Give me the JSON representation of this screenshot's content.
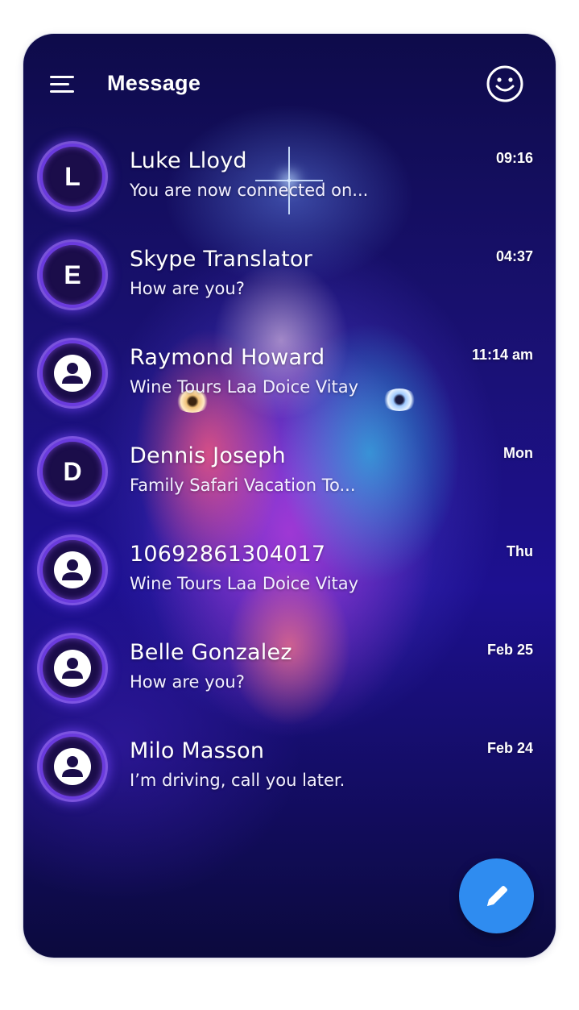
{
  "header": {
    "title": "Message",
    "menu_icon": "hamburger-menu-icon",
    "theme_icon": "smiley-face-icon"
  },
  "conversations": [
    {
      "avatar_type": "letter",
      "initial": "L",
      "name": "Luke Lloyd",
      "preview": "You are now connected on...",
      "time": "09:16"
    },
    {
      "avatar_type": "letter",
      "initial": "E",
      "name": "Skype Translator",
      "preview": "How are you?",
      "time": "04:37"
    },
    {
      "avatar_type": "person",
      "initial": "",
      "name": "Raymond Howard",
      "preview": "Wine Tours Laa Doice Vitay",
      "time": "11:14 am"
    },
    {
      "avatar_type": "letter",
      "initial": "D",
      "name": "Dennis Joseph",
      "preview": "Family Safari Vacation To...",
      "time": "Mon"
    },
    {
      "avatar_type": "person",
      "initial": "",
      "name": "10692861304017",
      "preview": "Wine Tours Laa Doice Vitay",
      "time": "Thu"
    },
    {
      "avatar_type": "person",
      "initial": "",
      "name": "Belle Gonzalez",
      "preview": "How are you?",
      "time": "Feb 25"
    },
    {
      "avatar_type": "person",
      "initial": "",
      "name": "Milo Masson",
      "preview": "I’m driving, call you later.",
      "time": "Feb 24"
    }
  ],
  "compose": {
    "icon": "pencil-icon",
    "color": "#2f8cf0"
  },
  "colors": {
    "avatar_ring": "#6a3bdd",
    "background_dark": "#0e0b4a",
    "text": "#ffffff"
  }
}
